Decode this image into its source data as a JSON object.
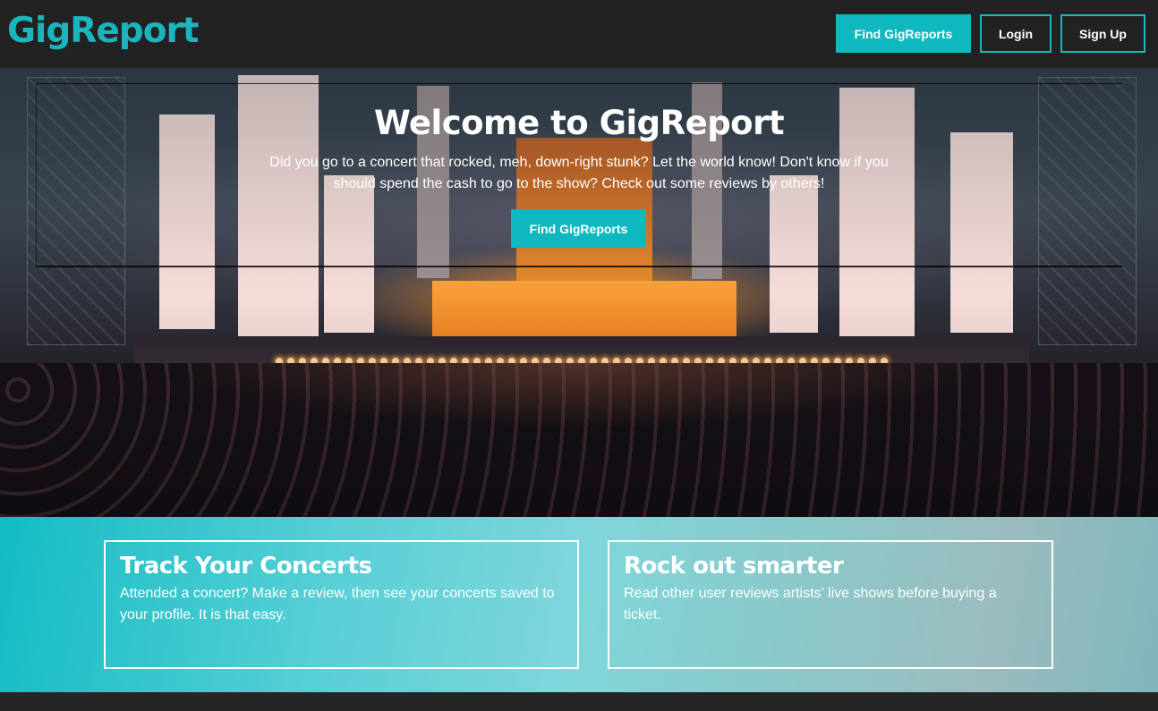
{
  "navbar": {
    "brand": "GigReport",
    "find_label": "Find GigReports",
    "login_label": "Login",
    "signup_label": "Sign Up"
  },
  "hero": {
    "title": "Welcome to GigReport",
    "text": "Did you go to a concert that rocked, meh, down-right stunk? Let the world know! Don't know if you should spend the cash to go to the show? Check out some reviews by others!",
    "button_label": "Find GigReports"
  },
  "features": [
    {
      "title": "Track Your Concerts",
      "text": "Attended a concert? Make a review, then see your concerts saved to your profile. It is that easy."
    },
    {
      "title": "Rock out smarter",
      "text": "Read other user reviews artists' live shows before buying a ticket."
    }
  ],
  "colors": {
    "accent": "#0fb8bf",
    "navbar_bg": "#222222",
    "text_light": "#ffffff"
  }
}
